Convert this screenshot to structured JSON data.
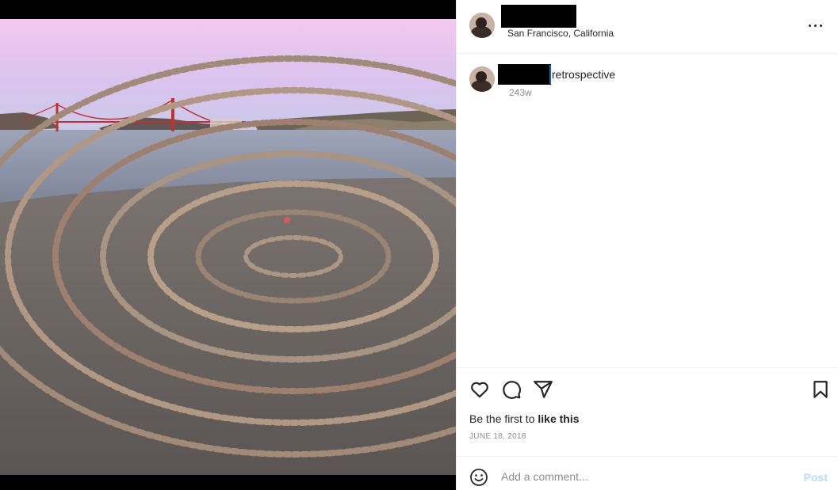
{
  "post": {
    "location": "San Francisco, California",
    "caption": "retrospective",
    "time_ago": "243w",
    "likes_prefix": "Be the first to ",
    "likes_action": "like this",
    "date": "JUNE 18, 2018"
  },
  "comment_box": {
    "placeholder": "Add a comment...",
    "post_label": "Post"
  },
  "icons": {
    "more": "more-horizontal-icon",
    "like": "heart-icon",
    "comment": "speech-bubble-icon",
    "share": "paper-plane-icon",
    "save": "bookmark-icon",
    "emoji": "smiley-face-icon"
  },
  "colors": {
    "text": "#262626",
    "secondary": "#8e8e8e",
    "divider": "#efefef",
    "post_disabled": "#b2dffc",
    "bridge": "#c0312f"
  }
}
